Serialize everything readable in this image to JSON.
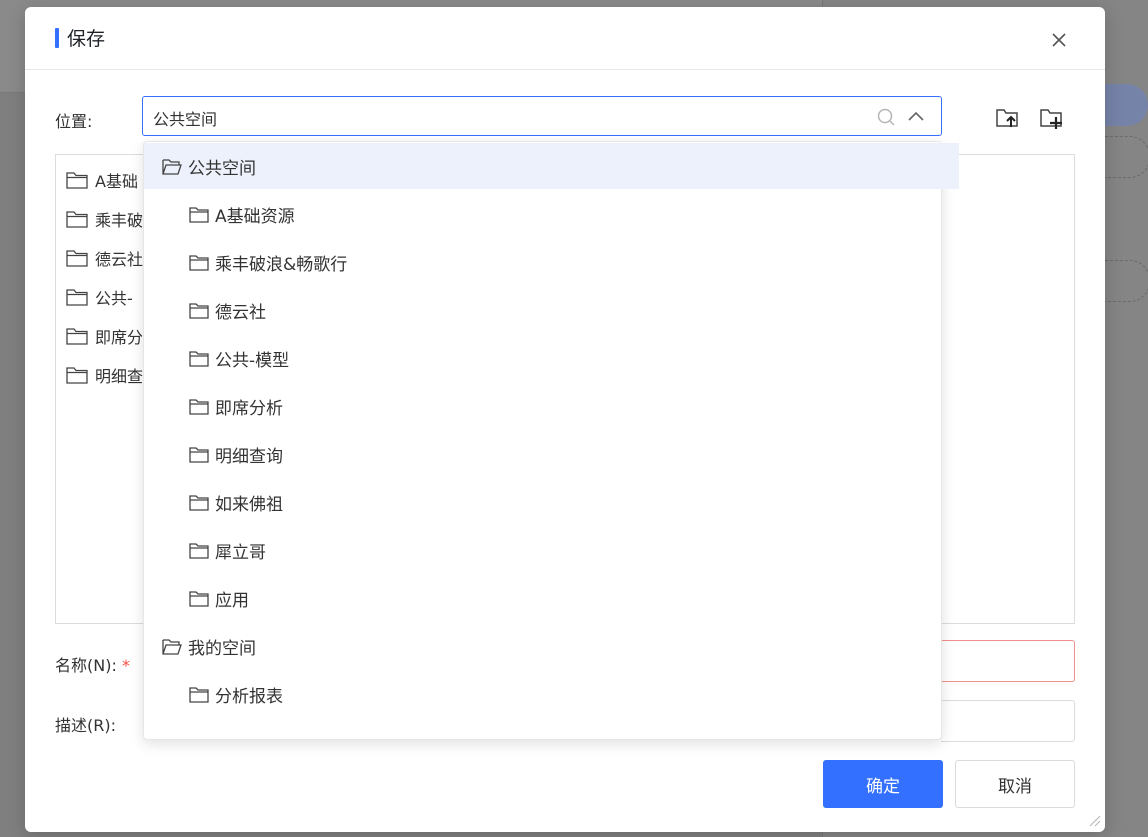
{
  "dialog": {
    "title": "保存",
    "location_label": "位置:",
    "location_value": "公共空间",
    "name_label": "名称(N):",
    "name_required_mark": "*",
    "desc_label": "描述(R):",
    "confirm_label": "确定",
    "cancel_label": "取消"
  },
  "tree": {
    "items": [
      {
        "label": "A基础"
      },
      {
        "label": "乘丰破"
      },
      {
        "label": "德云社"
      },
      {
        "label": "公共-"
      },
      {
        "label": "即席分"
      },
      {
        "label": "明细查"
      }
    ]
  },
  "dropdown": {
    "items": [
      {
        "label": "公共空间",
        "level": 0,
        "icon": "folder-open-icon",
        "selected": true
      },
      {
        "label": "A基础资源",
        "level": 1,
        "icon": "folder-icon"
      },
      {
        "label": "乘丰破浪&畅歌行",
        "level": 1,
        "icon": "folder-icon"
      },
      {
        "label": "德云社",
        "level": 1,
        "icon": "folder-icon"
      },
      {
        "label": "公共-模型",
        "level": 1,
        "icon": "folder-icon"
      },
      {
        "label": "即席分析",
        "level": 1,
        "icon": "folder-icon"
      },
      {
        "label": "明细查询",
        "level": 1,
        "icon": "folder-icon"
      },
      {
        "label": "如来佛祖",
        "level": 1,
        "icon": "folder-icon"
      },
      {
        "label": "犀立哥",
        "level": 1,
        "icon": "folder-icon"
      },
      {
        "label": "应用",
        "level": 1,
        "icon": "folder-icon"
      },
      {
        "label": "我的空间",
        "level": 0,
        "icon": "folder-open-icon"
      },
      {
        "label": "分析报表",
        "level": 1,
        "icon": "folder-icon"
      }
    ]
  },
  "colors": {
    "accent": "#3370ff",
    "selected_bg": "#edf1fb",
    "error_border": "#f0908c"
  }
}
